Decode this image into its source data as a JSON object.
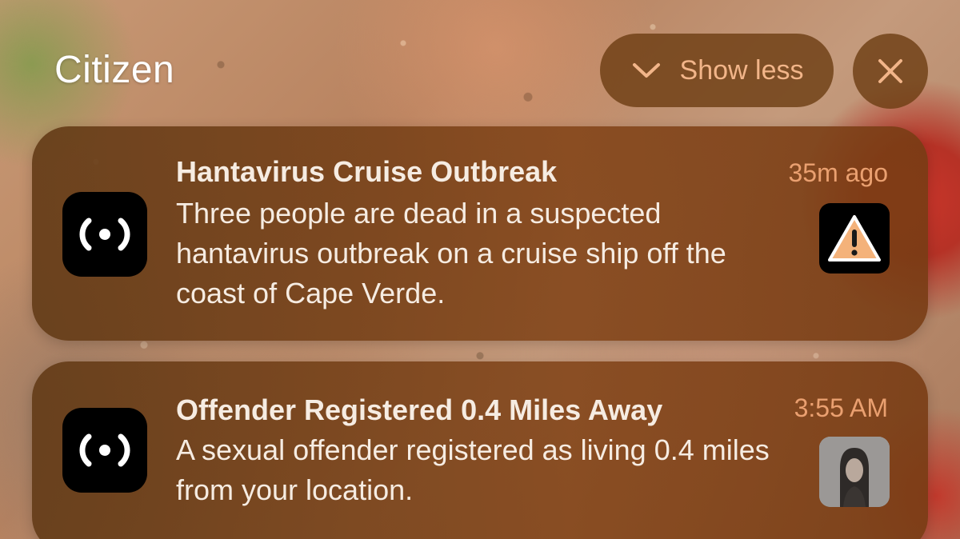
{
  "header": {
    "app_name": "Citizen",
    "show_less_label": "Show less",
    "show_less_icon": "chevron-down-icon",
    "close_icon": "close-icon",
    "accent_color": "#f2b589"
  },
  "notifications": [
    {
      "app_icon": "citizen-broadcast-icon",
      "title": "Hantavirus Cruise Outbreak",
      "time": "35m ago",
      "body": "Three people are dead in a suspected hantavirus outbreak on a cruise ship off the coast of Cape Verde.",
      "thumbnail": "warning-icon"
    },
    {
      "app_icon": "citizen-broadcast-icon",
      "title": "Offender Registered 0.4 Miles Away",
      "time": "3:55 AM",
      "body": "A sexual offender registered as living 0.4 miles from your location.",
      "thumbnail": "person-photo"
    }
  ]
}
